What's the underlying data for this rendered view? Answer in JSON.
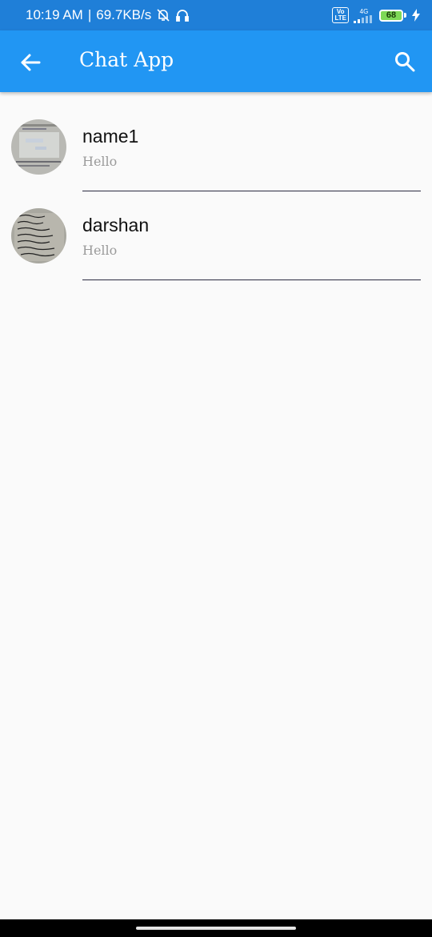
{
  "status_bar": {
    "time": "10:19 AM",
    "net_speed": "69.7KB/s",
    "volte": "Vo LTE",
    "network": "4G",
    "battery": "68"
  },
  "app_bar": {
    "title": "Chat App",
    "back_icon": "arrow-left-icon",
    "search_icon": "search-icon"
  },
  "chats": [
    {
      "name": "name1",
      "preview": "Hello"
    },
    {
      "name": "darshan",
      "preview": "Hello"
    }
  ],
  "colors": {
    "status_bar": "#1f7fd8",
    "app_bar": "#2196f3",
    "background": "#fafafa"
  }
}
